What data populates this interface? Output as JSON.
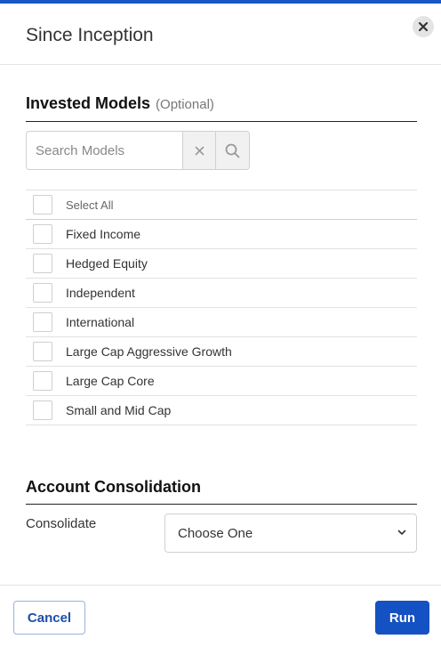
{
  "dialog": {
    "title": "Since Inception",
    "close_icon": "close-icon",
    "accent_color": "#1451c2"
  },
  "invested_models": {
    "heading": "Invested Models",
    "optional_label": "(Optional)",
    "search": {
      "placeholder": "Search Models",
      "value": ""
    },
    "select_all_label": "Select All",
    "items": [
      {
        "label": "Fixed Income",
        "checked": false
      },
      {
        "label": "Hedged Equity",
        "checked": false
      },
      {
        "label": "Independent",
        "checked": false
      },
      {
        "label": "International",
        "checked": false
      },
      {
        "label": "Large Cap Aggressive Growth",
        "checked": false
      },
      {
        "label": "Large Cap Core",
        "checked": false
      },
      {
        "label": "Small and Mid Cap",
        "checked": false
      }
    ]
  },
  "account_consolidation": {
    "heading": "Account Consolidation",
    "consolidate_label": "Consolidate",
    "consolidate_value": "Choose One"
  },
  "footer": {
    "cancel_label": "Cancel",
    "run_label": "Run"
  }
}
